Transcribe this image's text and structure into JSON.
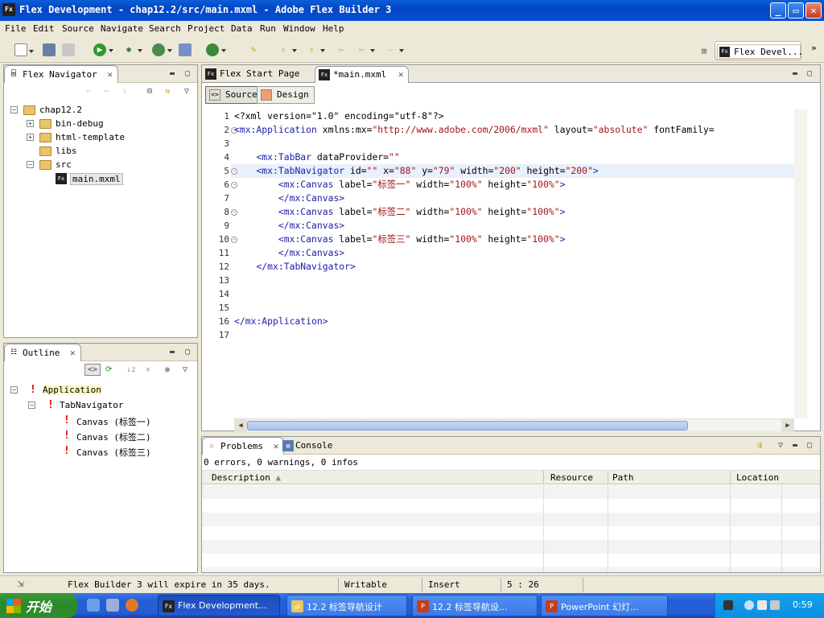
{
  "window": {
    "title": "Flex Development - chap12.2/src/main.mxml - Adobe Flex Builder 3",
    "app_icon": "Fx"
  },
  "menu": [
    "File",
    "Edit",
    "Source",
    "Navigate",
    "Search",
    "Project",
    "Data",
    "Run",
    "Window",
    "Help"
  ],
  "perspective": {
    "label": "Flex Devel...",
    "chevron": "»"
  },
  "navigator": {
    "tab": "Flex Navigator",
    "tree": [
      {
        "label": "chap12.2",
        "level": 0,
        "expanded": true
      },
      {
        "label": "bin-debug",
        "level": 1,
        "expander": "+"
      },
      {
        "label": "html-template",
        "level": 1,
        "expander": "+"
      },
      {
        "label": "libs",
        "level": 1,
        "expander": ""
      },
      {
        "label": "src",
        "level": 1,
        "expanded": true
      },
      {
        "label": "main.mxml",
        "level": 2,
        "selected": true,
        "file": true
      }
    ]
  },
  "outline": {
    "tab": "Outline",
    "tree": [
      {
        "label": "Application",
        "level": 0,
        "highlight": true
      },
      {
        "label": "TabNavigator",
        "level": 1
      },
      {
        "label": "Canvas (标签一)",
        "level": 2
      },
      {
        "label": "Canvas (标签二)",
        "level": 2
      },
      {
        "label": "Canvas (标签三)",
        "level": 2
      }
    ]
  },
  "editor": {
    "tabs": [
      {
        "label": "Flex Start Page",
        "active": false
      },
      {
        "label": "*main.mxml",
        "active": true
      }
    ],
    "modes": [
      {
        "label": "Source",
        "active": true
      },
      {
        "label": "Design",
        "active": false
      }
    ],
    "lines": [
      {
        "n": "1",
        "fold": false,
        "tokens": [
          [
            "cm",
            "<?xml version=\"1.0\" encoding=\"utf-8\"?>"
          ]
        ]
      },
      {
        "n": "2",
        "fold": true,
        "tokens": [
          [
            "tg",
            "<mx:Application"
          ],
          [
            "at",
            " xmlns:mx="
          ],
          [
            "vl",
            "\"http://www.adobe.com/2006/mxml\""
          ],
          [
            "at",
            " layout="
          ],
          [
            "vl",
            "\"absolute\""
          ],
          [
            "at",
            " fontFamily="
          ]
        ]
      },
      {
        "n": "3",
        "fold": false,
        "tokens": []
      },
      {
        "n": "4",
        "fold": false,
        "tokens": [
          [
            "at",
            "    "
          ],
          [
            "tg",
            "<mx:TabBar"
          ],
          [
            "at",
            " dataProvider="
          ],
          [
            "vl",
            "\"\""
          ]
        ]
      },
      {
        "n": "5",
        "fold": true,
        "highlight": true,
        "tokens": [
          [
            "at",
            "    "
          ],
          [
            "tg",
            "<mx:TabNavigator"
          ],
          [
            "at",
            " id="
          ],
          [
            "vl",
            "\"\""
          ],
          [
            "at",
            " x="
          ],
          [
            "vl",
            "\"88\""
          ],
          [
            "at",
            " y="
          ],
          [
            "vl",
            "\"79\""
          ],
          [
            "at",
            " width="
          ],
          [
            "vl",
            "\"200\""
          ],
          [
            "at",
            " height="
          ],
          [
            "vl",
            "\"200\""
          ],
          [
            "tg",
            ">"
          ]
        ]
      },
      {
        "n": "6",
        "fold": true,
        "tokens": [
          [
            "at",
            "        "
          ],
          [
            "tg",
            "<mx:Canvas"
          ],
          [
            "at",
            " label="
          ],
          [
            "vl",
            "\"标签一\""
          ],
          [
            "at",
            " width="
          ],
          [
            "vl",
            "\"100%\""
          ],
          [
            "at",
            " height="
          ],
          [
            "vl",
            "\"100%\""
          ],
          [
            "tg",
            ">"
          ]
        ]
      },
      {
        "n": "7",
        "fold": false,
        "tokens": [
          [
            "at",
            "        "
          ],
          [
            "tg",
            "</mx:Canvas>"
          ]
        ]
      },
      {
        "n": "8",
        "fold": true,
        "tokens": [
          [
            "at",
            "        "
          ],
          [
            "tg",
            "<mx:Canvas"
          ],
          [
            "at",
            " label="
          ],
          [
            "vl",
            "\"标签二\""
          ],
          [
            "at",
            " width="
          ],
          [
            "vl",
            "\"100%\""
          ],
          [
            "at",
            " height="
          ],
          [
            "vl",
            "\"100%\""
          ],
          [
            "tg",
            ">"
          ]
        ]
      },
      {
        "n": "9",
        "fold": false,
        "tokens": [
          [
            "at",
            "        "
          ],
          [
            "tg",
            "</mx:Canvas>"
          ]
        ]
      },
      {
        "n": "10",
        "fold": true,
        "tokens": [
          [
            "at",
            "        "
          ],
          [
            "tg",
            "<mx:Canvas"
          ],
          [
            "at",
            " label="
          ],
          [
            "vl",
            "\"标签三\""
          ],
          [
            "at",
            " width="
          ],
          [
            "vl",
            "\"100%\""
          ],
          [
            "at",
            " height="
          ],
          [
            "vl",
            "\"100%\""
          ],
          [
            "tg",
            ">"
          ]
        ]
      },
      {
        "n": "11",
        "fold": false,
        "tokens": [
          [
            "at",
            "        "
          ],
          [
            "tg",
            "</mx:Canvas>"
          ]
        ]
      },
      {
        "n": "12",
        "fold": false,
        "tokens": [
          [
            "at",
            "    "
          ],
          [
            "tg",
            "</mx:TabNavigator>"
          ]
        ]
      },
      {
        "n": "13",
        "fold": false,
        "tokens": []
      },
      {
        "n": "14",
        "fold": false,
        "tokens": []
      },
      {
        "n": "15",
        "fold": false,
        "tokens": []
      },
      {
        "n": "16",
        "fold": false,
        "tokens": [
          [
            "tg",
            "</mx:Application>"
          ]
        ]
      },
      {
        "n": "17",
        "fold": false,
        "tokens": []
      }
    ]
  },
  "problems": {
    "tabs": [
      {
        "label": "Problems",
        "active": true
      },
      {
        "label": "Console",
        "active": false
      }
    ],
    "summary": "0 errors, 0 warnings, 0 infos",
    "columns": [
      "Description",
      "Resource",
      "Path",
      "Location"
    ]
  },
  "statusbar": {
    "message": "Flex Builder 3 will expire in 35 days.",
    "writable": "Writable",
    "mode": "Insert",
    "position": "5 : 26"
  },
  "taskbar": {
    "start": "开始",
    "tasks": [
      {
        "label": "Flex Development...",
        "icon": "Fx",
        "color": "#222222",
        "active": true
      },
      {
        "label": "12.2 标签导航设计",
        "icon": "📁",
        "color": "#e9c46a",
        "active": false
      },
      {
        "label": "12.2 标签导航设...",
        "icon": "P",
        "color": "#c43e1c",
        "active": false
      },
      {
        "label": "PowerPoint 幻灯...",
        "icon": "P",
        "color": "#c43e1c",
        "active": false
      }
    ],
    "clock": "0:59"
  },
  "colors": {
    "tag": "#1c1ca8",
    "value": "#a31515",
    "selection": "#e8f0fc",
    "error": "#e00000"
  }
}
